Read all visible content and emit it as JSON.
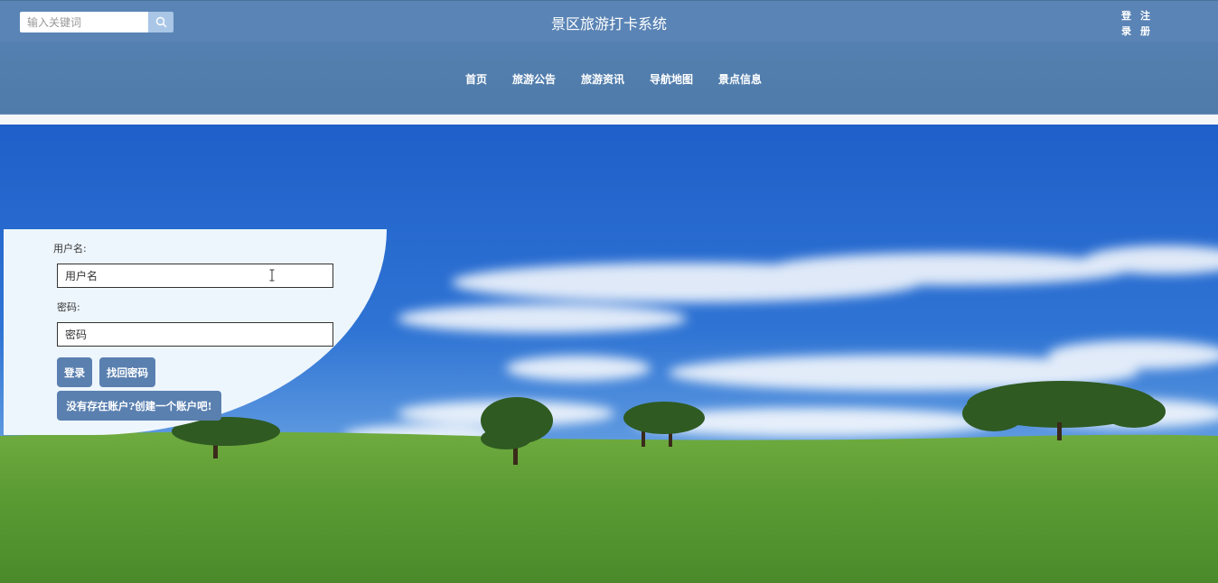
{
  "header": {
    "search_placeholder": "输入关键词",
    "search_icon": "search-icon",
    "title": "景区旅游打卡系统",
    "login_link": "登录",
    "register_link": "注册"
  },
  "nav": {
    "items": [
      "首页",
      "旅游公告",
      "旅游资讯",
      "导航地图",
      "景点信息"
    ]
  },
  "login_form": {
    "username_label": "用户名:",
    "username_placeholder": "用户名",
    "password_label": "密码:",
    "password_placeholder": "密码",
    "login_button": "登录",
    "forgot_button": "找回密码",
    "register_button": "没有存在账户?创建一个账户吧!"
  },
  "colors": {
    "header_bg": "#5a84b5",
    "nav_bg": "#5380b0",
    "button_bg": "#5a80b0",
    "panel_bg": "#eef6fd"
  }
}
